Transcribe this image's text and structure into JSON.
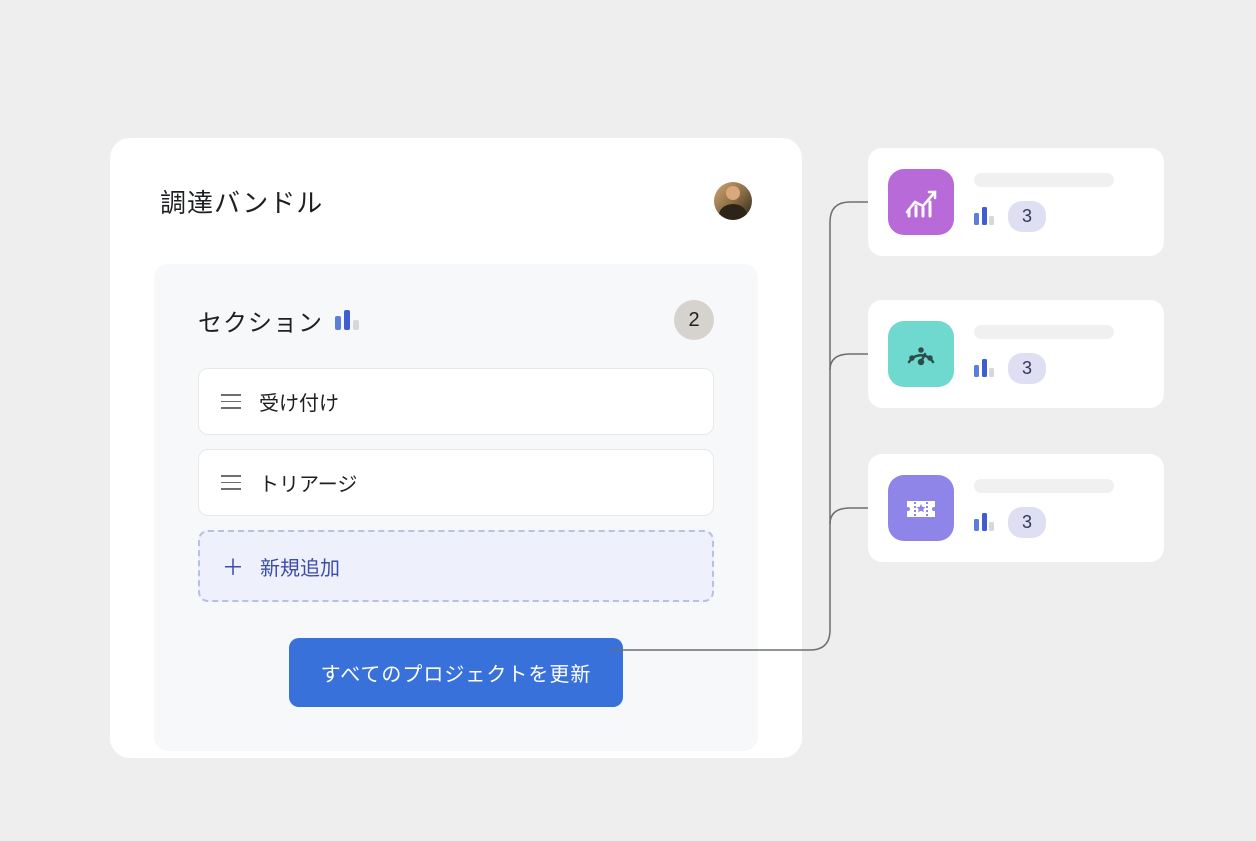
{
  "card": {
    "title": "調達バンドル"
  },
  "section": {
    "title": "セクション",
    "count": "2",
    "items": [
      {
        "label": "受け付け"
      },
      {
        "label": "トリアージ"
      }
    ],
    "add_label": "新規追加"
  },
  "actions": {
    "update_all": "すべてのプロジェクトを更新"
  },
  "projects": [
    {
      "icon": "growth",
      "bg": "#b96ad9",
      "count": "3"
    },
    {
      "icon": "gauge",
      "bg": "#6fd9cf",
      "count": "3"
    },
    {
      "icon": "ticket",
      "bg": "#8f84e8",
      "count": "3"
    }
  ]
}
